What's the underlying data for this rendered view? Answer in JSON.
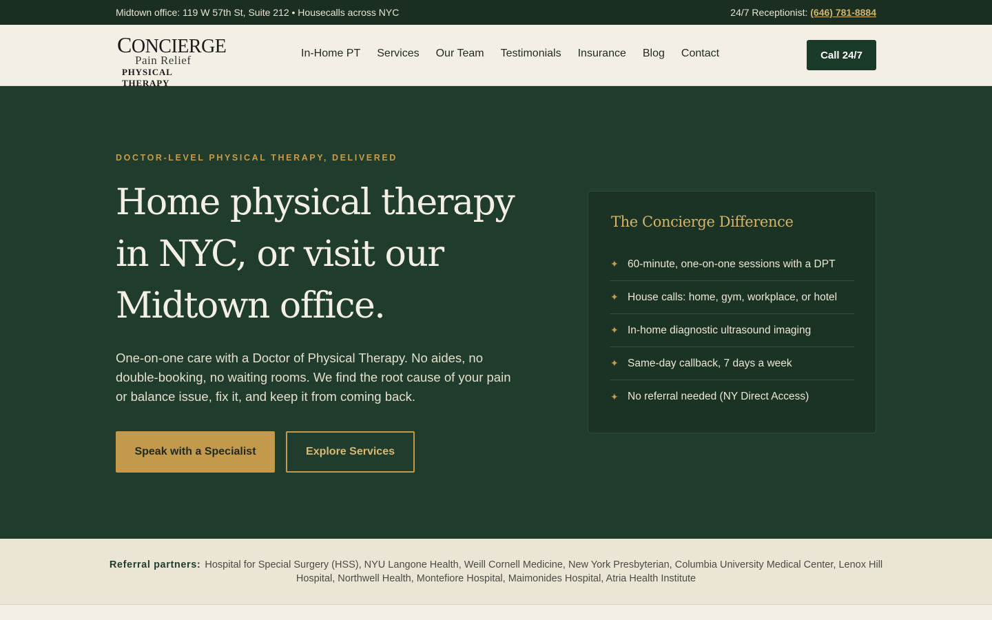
{
  "topbar": {
    "left_text": "Midtown office: 119 W 57th St, Suite 212 • Housecalls across NYC",
    "receptionist_label": "24/7 Receptionist:",
    "phone": "(646) 781-8884"
  },
  "logo": {
    "line1_cap": "C",
    "line1_rest": "ONCIERGE",
    "line2": "Pain Relief",
    "line3": "PHYSICAL THERAPY"
  },
  "nav": {
    "items": [
      "In-Home PT",
      "Services",
      "Our Team",
      "Testimonials",
      "Insurance",
      "Blog",
      "Contact"
    ],
    "cta": "Call 24/7"
  },
  "hero": {
    "eyebrow": "DOCTOR-LEVEL PHYSICAL THERAPY, DELIVERED",
    "title": "Home physical therapy in NYC, or visit our Midtown office.",
    "description": "One-on-one care with a Doctor of Physical Therapy. No aides, no double-booking, no waiting rooms. We find the root cause of your pain or balance issue, fix it, and keep it from coming back.",
    "primary_button": "Speak with a Specialist",
    "secondary_button": "Explore Services"
  },
  "card": {
    "title": "The Concierge Difference",
    "items": [
      "60-minute, one-on-one sessions with a DPT",
      "House calls: home, gym, workplace, or hotel",
      "In-home diagnostic ultrasound imaging",
      "Same-day callback, 7 days a week",
      "No referral needed (NY Direct Access)"
    ],
    "bullet": "✦"
  },
  "referral": {
    "label": "Referral partners:",
    "partners": "Hospital for Special Surgery (HSS), NYU Langone Health, Weill Cornell Medicine, New York Presbyterian, Columbia University Medical Center, Lenox Hill Hospital, Northwell Health, Montefiore Hospital, Maimonides Hospital, Atria Health Institute"
  },
  "colors": {
    "dark_green": "#1f3c2c",
    "topbar_green": "#1a2e21",
    "gold": "#c39a4c",
    "cream": "#f4efe4"
  }
}
